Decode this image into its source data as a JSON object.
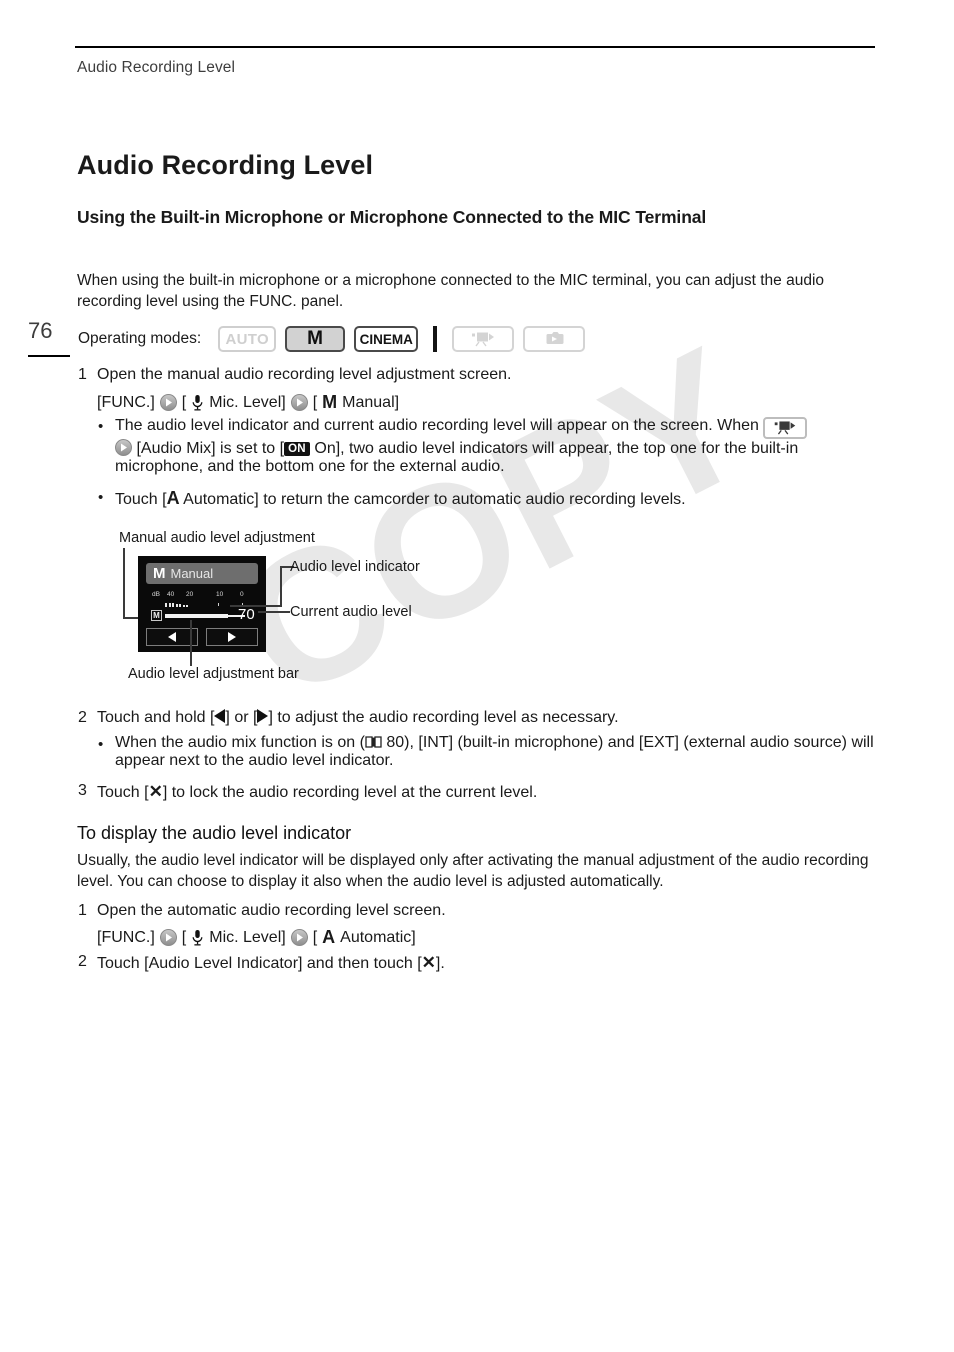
{
  "running_head": "Audio Recording Level",
  "folio": "76",
  "title": "Audio Recording Level",
  "subtitle": "Using the Built-in Microphone or Microphone Connected to the MIC Terminal",
  "intro": "When using the built-in microphone or a microphone connected to the MIC terminal, you can adjust the audio recording level using the FUNC. panel.",
  "operating_modes": {
    "label": "Operating modes:",
    "badges": [
      {
        "name": "auto",
        "text": "AUTO",
        "state": "inactive"
      },
      {
        "name": "manual",
        "text": "M",
        "state": "active"
      },
      {
        "name": "cinema",
        "text": "CINEMA",
        "state": "available"
      }
    ],
    "playback_icons": [
      {
        "name": "movie-playback-icon",
        "state": "inactive"
      },
      {
        "name": "photo-playback-icon",
        "state": "inactive"
      }
    ]
  },
  "procedure_1": {
    "step1": {
      "num": "1",
      "text": "Open the manual audio recording level adjustment screen.",
      "sequence": {
        "func": "[FUNC.]",
        "mic_level": "Mic. Level]",
        "mic_open": "[",
        "manual_open": "[",
        "manual_m": "M",
        "manual_label": "Manual]"
      },
      "bullets": [
        {
          "part1": "The audio level indicator and current audio recording level will appear on the screen. When",
          "part2": "[Audio Mix] is set to [",
          "on_badge": "ON",
          "part3": "On], two audio level indicators will appear, the top one for the built-in microphone, and the bottom one for the external audio."
        },
        {
          "pre": "Touch [",
          "bold": "A",
          "post": "Automatic] to return the camcorder to automatic audio recording levels."
        }
      ]
    },
    "step2": {
      "num": "2",
      "pre": "Touch and hold [",
      "mid": "] or [",
      "post": "] to adjust the audio recording level as necessary.",
      "bullet": {
        "pre": "When the audio mix function is on (",
        "page": "80",
        "post": "), [INT] (built-in microphone) and [EXT] (external audio source) will appear next to the audio level indicator."
      }
    },
    "step3": {
      "num": "3",
      "pre": "Touch [",
      "x": "✕",
      "post": "] to lock the audio recording level at the current level."
    }
  },
  "figure": {
    "caption_top": "Manual audio level adjustment",
    "caption_indicator": "Audio level indicator",
    "caption_current": "Current audio level",
    "caption_bottom": "Audio level adjustment bar",
    "lcd": {
      "mode_badge": "M",
      "mode_label": "Manual",
      "scale": {
        "unit": "dB",
        "ticks": [
          "40",
          "20",
          "10",
          "0"
        ]
      },
      "indicator_badge": "M",
      "level_value": "70",
      "left_button": "◀",
      "right_button": "▶"
    }
  },
  "section": {
    "heading": "To display the audio level indicator",
    "body": "Usually, the audio level indicator will be displayed only after activating the manual adjustment of the audio recording level. You can choose to display it also when the audio level is adjusted automatically.",
    "step1": {
      "num": "1",
      "text": "Open the automatic audio recording level screen.",
      "sequence": {
        "func": "[FUNC.]",
        "mic_open": "[",
        "mic_level": "Mic. Level]",
        "auto_open": "[",
        "auto_a": "A",
        "auto_label": "Automatic]"
      }
    },
    "step2": {
      "num": "2",
      "pre": "Touch [Audio Level Indicator] and then touch [",
      "x": "✕",
      "post": "]."
    }
  },
  "watermark": {
    "text": "COPY"
  },
  "colors": {
    "text": "#1a1a1a",
    "rule": "#000000",
    "watermark": "#e8e8e8",
    "lcd_bg": "#0a0a0a",
    "badge_active_bg": "#d2d2d2",
    "badge_inactive": "#cfcfcf"
  }
}
